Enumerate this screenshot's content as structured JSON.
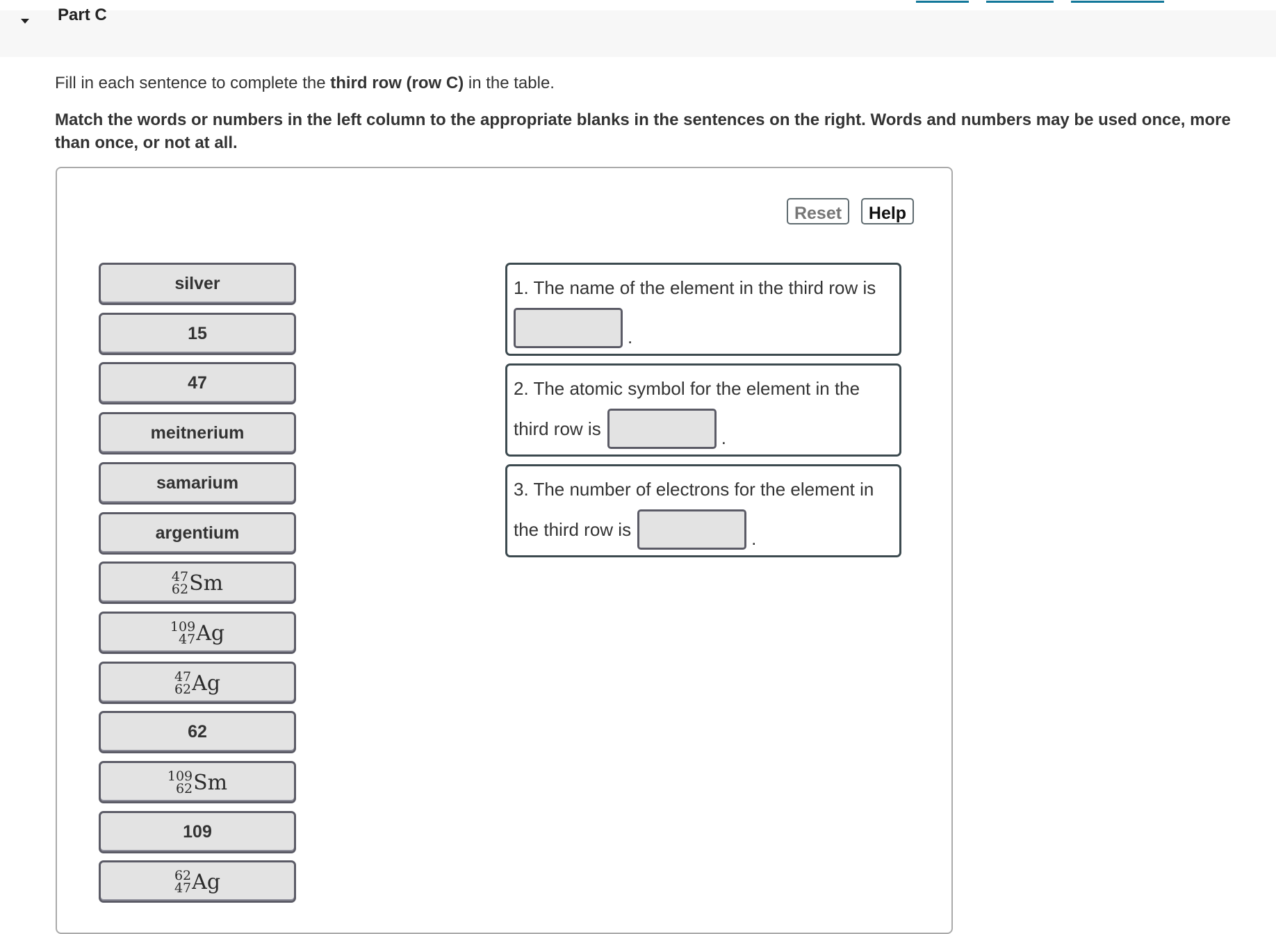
{
  "header": {
    "part_title": "Part C",
    "collapse_icon": "caret-down-icon",
    "link_color": "#117799"
  },
  "intro": {
    "prefix": "Fill in each sentence to complete the ",
    "bold": "third row (row C)",
    "suffix": " in the table."
  },
  "instructions": "Match the words or numbers in the left column to the appropriate blanks in the sentences on the right. Words and numbers may be used once, more than once, or not at all.",
  "toolbar": {
    "reset_label": "Reset",
    "help_label": "Help"
  },
  "tokens": [
    {
      "type": "text",
      "label": "silver"
    },
    {
      "type": "text",
      "label": "15"
    },
    {
      "type": "text",
      "label": "47"
    },
    {
      "type": "text",
      "label": "meitnerium"
    },
    {
      "type": "text",
      "label": "samarium"
    },
    {
      "type": "text",
      "label": "argentium"
    },
    {
      "type": "isotope",
      "mass": "47",
      "atomic": "62",
      "symbol": "Sm"
    },
    {
      "type": "isotope",
      "mass": "109",
      "atomic": "47",
      "symbol": "Ag"
    },
    {
      "type": "isotope",
      "mass": "47",
      "atomic": "62",
      "symbol": "Ag"
    },
    {
      "type": "text",
      "label": "62"
    },
    {
      "type": "isotope",
      "mass": "109",
      "atomic": "62",
      "symbol": "Sm"
    },
    {
      "type": "text",
      "label": "109"
    },
    {
      "type": "isotope",
      "mass": "62",
      "atomic": "47",
      "symbol": "Ag"
    }
  ],
  "sentences": [
    {
      "line1": "1. The name of the element in the third row is",
      "line2_prefix": "",
      "blank_value": "",
      "end": "."
    },
    {
      "line1": "2. The atomic symbol for the element in the",
      "line2_prefix": "third row is",
      "blank_value": "",
      "end": "."
    },
    {
      "line1": "3. The number of electrons for the element in",
      "line2_prefix": "the third row is",
      "blank_value": "",
      "end": "."
    }
  ]
}
